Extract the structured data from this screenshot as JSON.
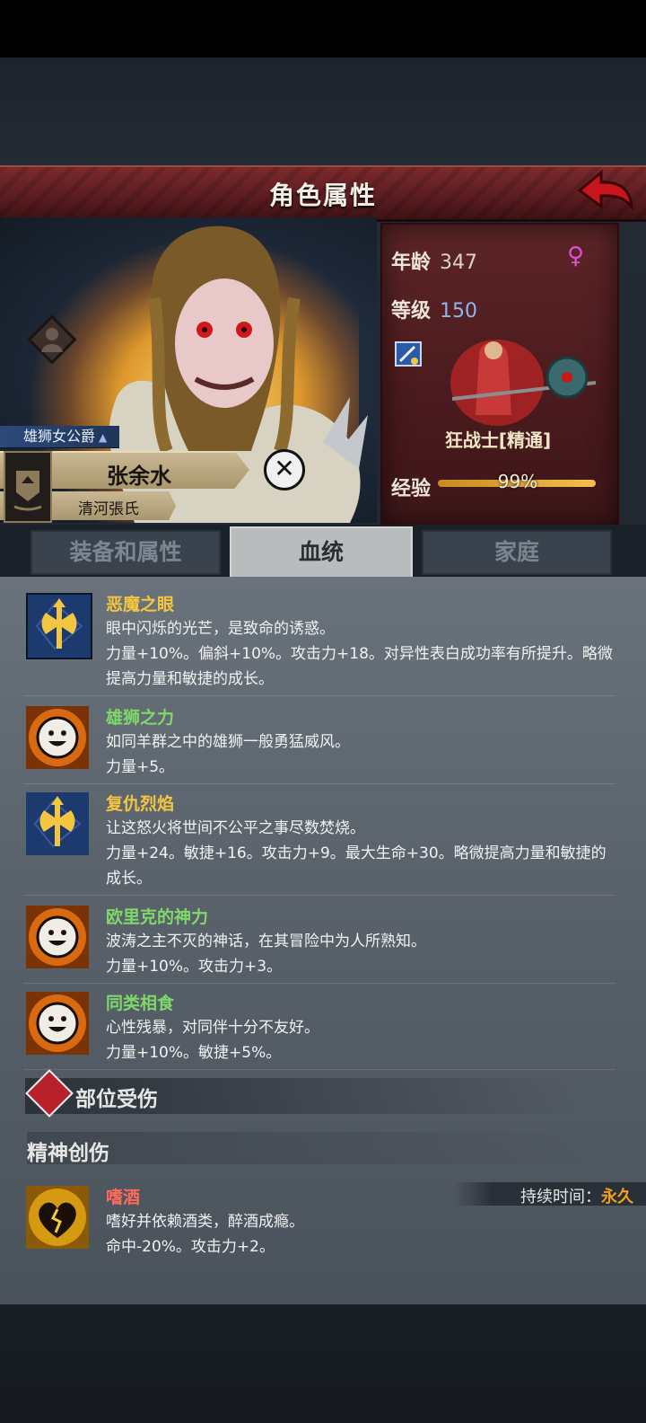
{
  "header": {
    "title": "角色属性"
  },
  "character": {
    "title": "雄狮女公爵",
    "name": "张余水",
    "family": "清河張氏"
  },
  "stats": {
    "age_label": "年龄",
    "age": "347",
    "level_label": "等级",
    "level": "150",
    "class_name": "狂战士[精通]",
    "exp_label": "经验",
    "exp_text": "99%",
    "exp_fraction": 0.99,
    "gender_symbol": "♀"
  },
  "tabs": [
    {
      "label": "装备和属性",
      "active": false
    },
    {
      "label": "血统",
      "active": true
    },
    {
      "label": "家庭",
      "active": false
    }
  ],
  "traits": [
    {
      "name": "恶魔之眼",
      "icon": "axe-icon",
      "color": "yellow",
      "desc": "眼中闪烁的光芒，是致命的诱惑。",
      "effect": "力量+10%。偏斜+10%。攻击力+18。对异性表白成功率有所提升。略微提高力量和敏捷的成长。"
    },
    {
      "name": "雄狮之力",
      "icon": "smile-icon",
      "color": "green",
      "desc": "如同羊群之中的雄狮一般勇猛威风。",
      "effect": "力量+5。"
    },
    {
      "name": "复仇烈焰",
      "icon": "axe-icon",
      "color": "yellow",
      "desc": "让这怒火将世间不公平之事尽数焚烧。",
      "effect": "力量+24。敏捷+16。攻击力+9。最大生命+30。略微提高力量和敏捷的成长。"
    },
    {
      "name": "欧里克的神力",
      "icon": "smile-icon",
      "color": "green",
      "desc": "波涛之主不灭的神话，在其冒险中为人所熟知。",
      "effect": "力量+10%。攻击力+3。"
    },
    {
      "name": "同类相食",
      "icon": "smile-icon",
      "color": "green",
      "desc": "心性残暴，对同伴十分不友好。",
      "effect": "力量+10%。敏捷+5%。"
    }
  ],
  "injury_section": {
    "title": "部位受伤"
  },
  "mental_section": {
    "title": "精神创伤"
  },
  "trauma": {
    "name": "嗜酒",
    "icon": "broken-heart-icon",
    "desc": "嗜好并依赖酒类，醉酒成瘾。",
    "effect": "命中-20%。攻击力+2。",
    "duration_label": "持续时间：",
    "duration_value": "永久"
  },
  "colors": {
    "header_red": "#5a1c20",
    "stats_panel": "#4a1b1e",
    "trait_good": "#7fd86a",
    "trait_gold": "#f2c640",
    "trait_bad": "#ff6a5a",
    "level_blue": "#8fb6ee",
    "duration_orange": "#f2a020"
  }
}
